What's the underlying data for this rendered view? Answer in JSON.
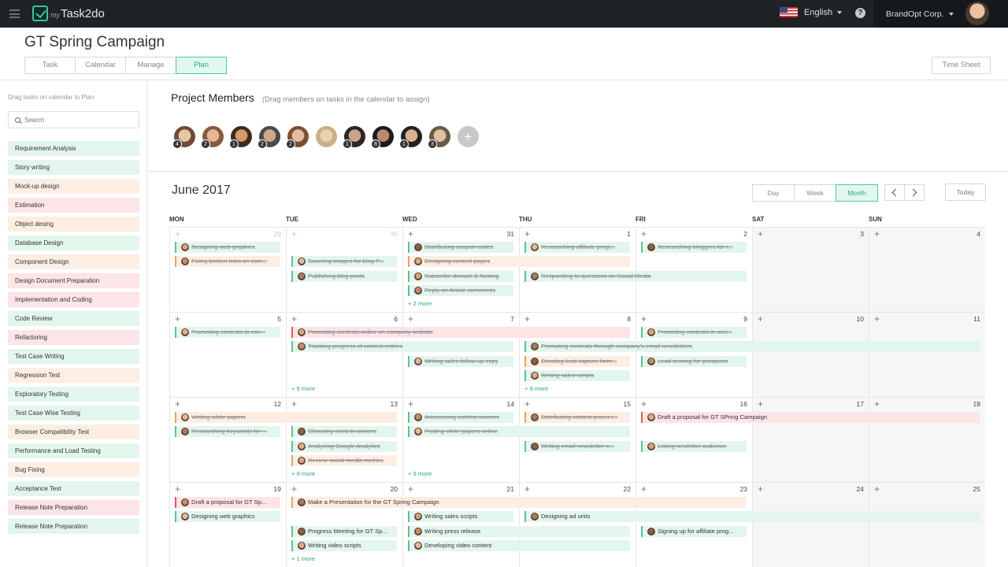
{
  "topbar": {
    "logo_prefix": "my",
    "logo_name": "Task2do",
    "language": "English",
    "help": "?",
    "organization": "BrandOpt Corp."
  },
  "project": {
    "title": "GT Spring Campaign",
    "tabs": [
      "Task",
      "Calendar",
      "Manage",
      "Plan"
    ],
    "active_tab": "Plan",
    "timesheet_label": "Time Sheet"
  },
  "sidebar": {
    "hint": "Drag tasks on calendar to Plan",
    "search_placeholder": "Search",
    "tasks": [
      {
        "label": "Requirement Analysis",
        "color": "#e3f6ee"
      },
      {
        "label": "Story writing",
        "color": "#e3f6ee"
      },
      {
        "label": "Mock-up design",
        "color": "#fdeee3"
      },
      {
        "label": "Estimation",
        "color": "#fde4e6"
      },
      {
        "label": "Object desing",
        "color": "#fdeee3"
      },
      {
        "label": "Database Design",
        "color": "#e3f6ee"
      },
      {
        "label": "Component Design",
        "color": "#fdeee3"
      },
      {
        "label": "Design Document Preparation",
        "color": "#fde4e6"
      },
      {
        "label": "Implementation and Coding",
        "color": "#fde4e6"
      },
      {
        "label": "Code Review",
        "color": "#e3f6ee"
      },
      {
        "label": "Refactoring",
        "color": "#fde4e6"
      },
      {
        "label": "Test Case Writing",
        "color": "#e3f6ee"
      },
      {
        "label": "Regression Test",
        "color": "#fdeee3"
      },
      {
        "label": "Exploratory Testing",
        "color": "#e3f6ee"
      },
      {
        "label": "Test Case Wise Testing",
        "color": "#e3f6ee"
      },
      {
        "label": "Browser Compatibility Test",
        "color": "#fdeee3"
      },
      {
        "label": "Performance and Load Testing",
        "color": "#e3f6ee"
      },
      {
        "label": "Bug Fixing",
        "color": "#fdeee3"
      },
      {
        "label": "Acceptance Test",
        "color": "#e3f6ee"
      },
      {
        "label": "Release Note Preparation",
        "color": "#fde4e6"
      },
      {
        "label": "Release Note Preparation",
        "color": "#e3f6ee"
      }
    ]
  },
  "members": {
    "title": "Project Members",
    "hint": "(Drag members  on tasks in the calendar to assign)",
    "counts": [
      "4",
      "2",
      "1",
      "2",
      "2",
      "",
      "1",
      "8",
      "1",
      "3"
    ],
    "add": "+"
  },
  "calendar": {
    "month_label": "June 2017",
    "views": [
      "Day",
      "Week",
      "Month"
    ],
    "active_view": "Month",
    "today_label": "Today",
    "weekdays": [
      "MON",
      "TUE",
      "WED",
      "THU",
      "FRI",
      "SAT",
      "SUN"
    ],
    "weeks": [
      [
        "29",
        "30",
        "31",
        "1",
        "2",
        "3",
        "4"
      ],
      [
        "5",
        "6",
        "7",
        "8",
        "9",
        "10",
        "11"
      ],
      [
        "12",
        "13",
        "14",
        "15",
        "16",
        "17",
        "18"
      ],
      [
        "19",
        "20",
        "21",
        "22",
        "23",
        "24",
        "25"
      ]
    ],
    "events": [
      {
        "week": 0,
        "day": 0,
        "span": 1,
        "lane": 0,
        "text": "Designing web graphics",
        "done": true,
        "type": "green"
      },
      {
        "week": 0,
        "day": 0,
        "span": 1,
        "lane": 1,
        "text": "Fixing broken links on com...",
        "done": true,
        "type": "orange"
      },
      {
        "week": 0,
        "day": 1,
        "span": 1,
        "lane": 1,
        "text": "Sourcing images for blog P...",
        "done": true,
        "type": "green"
      },
      {
        "week": 0,
        "day": 1,
        "span": 1,
        "lane": 2,
        "text": "Publishing blog posts",
        "done": true,
        "type": "green"
      },
      {
        "week": 0,
        "day": 2,
        "span": 1,
        "lane": 0,
        "text": "Distributing coupon codes",
        "done": true,
        "type": "green"
      },
      {
        "week": 0,
        "day": 2,
        "span": 2,
        "lane": 1,
        "text": "Designing contest pages",
        "done": true,
        "type": "orange"
      },
      {
        "week": 0,
        "day": 2,
        "span": 1,
        "lane": 2,
        "text": "Subscribe domain & hosting",
        "done": true,
        "type": "green"
      },
      {
        "week": 0,
        "day": 2,
        "span": 1,
        "lane": 3,
        "text": "Reply on Article comments",
        "done": true,
        "type": "green"
      },
      {
        "week": 0,
        "day": 3,
        "span": 1,
        "lane": 0,
        "text": "Researching affiliate progr...",
        "done": true,
        "type": "green"
      },
      {
        "week": 0,
        "day": 3,
        "span": 2,
        "lane": 2,
        "text": "Responding to questions on Social Media",
        "done": true,
        "type": "green"
      },
      {
        "week": 0,
        "day": 4,
        "span": 1,
        "lane": 0,
        "text": "Researching bloggers for r...",
        "done": true,
        "type": "green"
      },
      {
        "week": 1,
        "day": 0,
        "span": 1,
        "lane": 0,
        "text": "Promoting contests to con...",
        "done": true,
        "type": "green"
      },
      {
        "week": 1,
        "day": 1,
        "span": 3,
        "lane": 0,
        "text": "Promoting contests online on company website",
        "done": true,
        "type": "red"
      },
      {
        "week": 1,
        "day": 1,
        "span": 2,
        "lane": 1,
        "text": "Tracking progress of contest entries",
        "done": true,
        "type": "green"
      },
      {
        "week": 1,
        "day": 2,
        "span": 1,
        "lane": 2,
        "text": "Writing sales follow up copy",
        "done": true,
        "type": "green"
      },
      {
        "week": 1,
        "day": 3,
        "span": 4,
        "lane": 1,
        "text": "Promoting contests through company's email newsletters",
        "done": true,
        "type": "green"
      },
      {
        "week": 1,
        "day": 3,
        "span": 1,
        "lane": 2,
        "text": "Creating lead capture form...",
        "done": true,
        "type": "orange"
      },
      {
        "week": 1,
        "day": 3,
        "span": 1,
        "lane": 3,
        "text": "Writing sales scripts",
        "done": true,
        "type": "green"
      },
      {
        "week": 1,
        "day": 4,
        "span": 1,
        "lane": 0,
        "text": "Promoting contests in soci...",
        "done": true,
        "type": "green"
      },
      {
        "week": 1,
        "day": 4,
        "span": 1,
        "lane": 2,
        "text": "Lead scoring for prospects",
        "done": true,
        "type": "green"
      },
      {
        "week": 2,
        "day": 0,
        "span": 2,
        "lane": 0,
        "text": "Writing white papers",
        "done": true,
        "type": "orange"
      },
      {
        "week": 2,
        "day": 0,
        "span": 1,
        "lane": 1,
        "text": "Researching keywords for ...",
        "done": true,
        "type": "green"
      },
      {
        "week": 2,
        "day": 1,
        "span": 1,
        "lane": 1,
        "text": "Choosing contest winners",
        "done": true,
        "type": "green"
      },
      {
        "week": 2,
        "day": 1,
        "span": 1,
        "lane": 2,
        "text": "Analyzing Google Analytics",
        "done": true,
        "type": "green"
      },
      {
        "week": 2,
        "day": 1,
        "span": 1,
        "lane": 3,
        "text": "Review social media metrics",
        "done": true,
        "type": "orange"
      },
      {
        "week": 2,
        "day": 2,
        "span": 1,
        "lane": 0,
        "text": "Announcing contest winners",
        "done": true,
        "type": "green"
      },
      {
        "week": 2,
        "day": 2,
        "span": 2,
        "lane": 1,
        "text": "Posting white papers online",
        "done": true,
        "type": "green"
      },
      {
        "week": 2,
        "day": 3,
        "span": 1,
        "lane": 0,
        "text": "Distributing contest prizes t...",
        "done": true,
        "type": "orange"
      },
      {
        "week": 2,
        "day": 3,
        "span": 1,
        "lane": 2,
        "text": "Writing email newsletter c...",
        "done": true,
        "type": "green"
      },
      {
        "week": 2,
        "day": 4,
        "span": 3,
        "lane": 0,
        "text": "Draft a proposal for GT SPring Campaign",
        "done": false,
        "type": "red"
      },
      {
        "week": 2,
        "day": 4,
        "span": 1,
        "lane": 2,
        "text": "Listing newletter audience",
        "done": true,
        "type": "green"
      },
      {
        "week": 3,
        "day": 0,
        "span": 1,
        "lane": 0,
        "text": "Draft a proposal for GT Sp...",
        "done": false,
        "type": "red"
      },
      {
        "week": 3,
        "day": 0,
        "span": 1,
        "lane": 1,
        "text": "Designing web graphics",
        "done": false,
        "type": "green"
      },
      {
        "week": 3,
        "day": 1,
        "span": 4,
        "lane": 0,
        "text": "Make a Presentation for the GT Spring Campaign",
        "done": false,
        "type": "orange"
      },
      {
        "week": 3,
        "day": 1,
        "span": 1,
        "lane": 2,
        "text": "Progress Meeting for GT Sp...",
        "done": false,
        "type": "green"
      },
      {
        "week": 3,
        "day": 1,
        "span": 1,
        "lane": 3,
        "text": "Writing video scripts",
        "done": false,
        "type": "green"
      },
      {
        "week": 3,
        "day": 2,
        "span": 1,
        "lane": 1,
        "text": "Writing sales scripts",
        "done": false,
        "type": "green"
      },
      {
        "week": 3,
        "day": 2,
        "span": 2,
        "lane": 2,
        "text": "Writing press release",
        "done": false,
        "type": "green"
      },
      {
        "week": 3,
        "day": 2,
        "span": 2,
        "lane": 3,
        "text": "Developing video content",
        "done": false,
        "type": "green"
      },
      {
        "week": 3,
        "day": 3,
        "span": 4,
        "lane": 1,
        "text": "Designing ad units",
        "done": false,
        "type": "green"
      },
      {
        "week": 3,
        "day": 4,
        "span": 1,
        "lane": 2,
        "text": "Signing up for affiliate prog...",
        "done": false,
        "type": "green"
      }
    ],
    "more_links": [
      {
        "week": 0,
        "day": 2,
        "text": "+ 2 more"
      },
      {
        "week": 1,
        "day": 1,
        "text": "+ 9 more"
      },
      {
        "week": 1,
        "day": 3,
        "text": "+ 9 more"
      },
      {
        "week": 2,
        "day": 1,
        "text": "+ 9 more"
      },
      {
        "week": 2,
        "day": 2,
        "text": "+ 9 more"
      },
      {
        "week": 3,
        "day": 1,
        "text": "+ 1 more"
      }
    ]
  },
  "colors": {
    "accent": "#2ecc9a",
    "green_bg": "#e3f6ee",
    "green_bar": "#5cc28f",
    "orange_bg": "#fdeee3",
    "orange_bar": "#f0a060",
    "red_bg": "#fde4e6",
    "red_bar": "#e25461"
  }
}
